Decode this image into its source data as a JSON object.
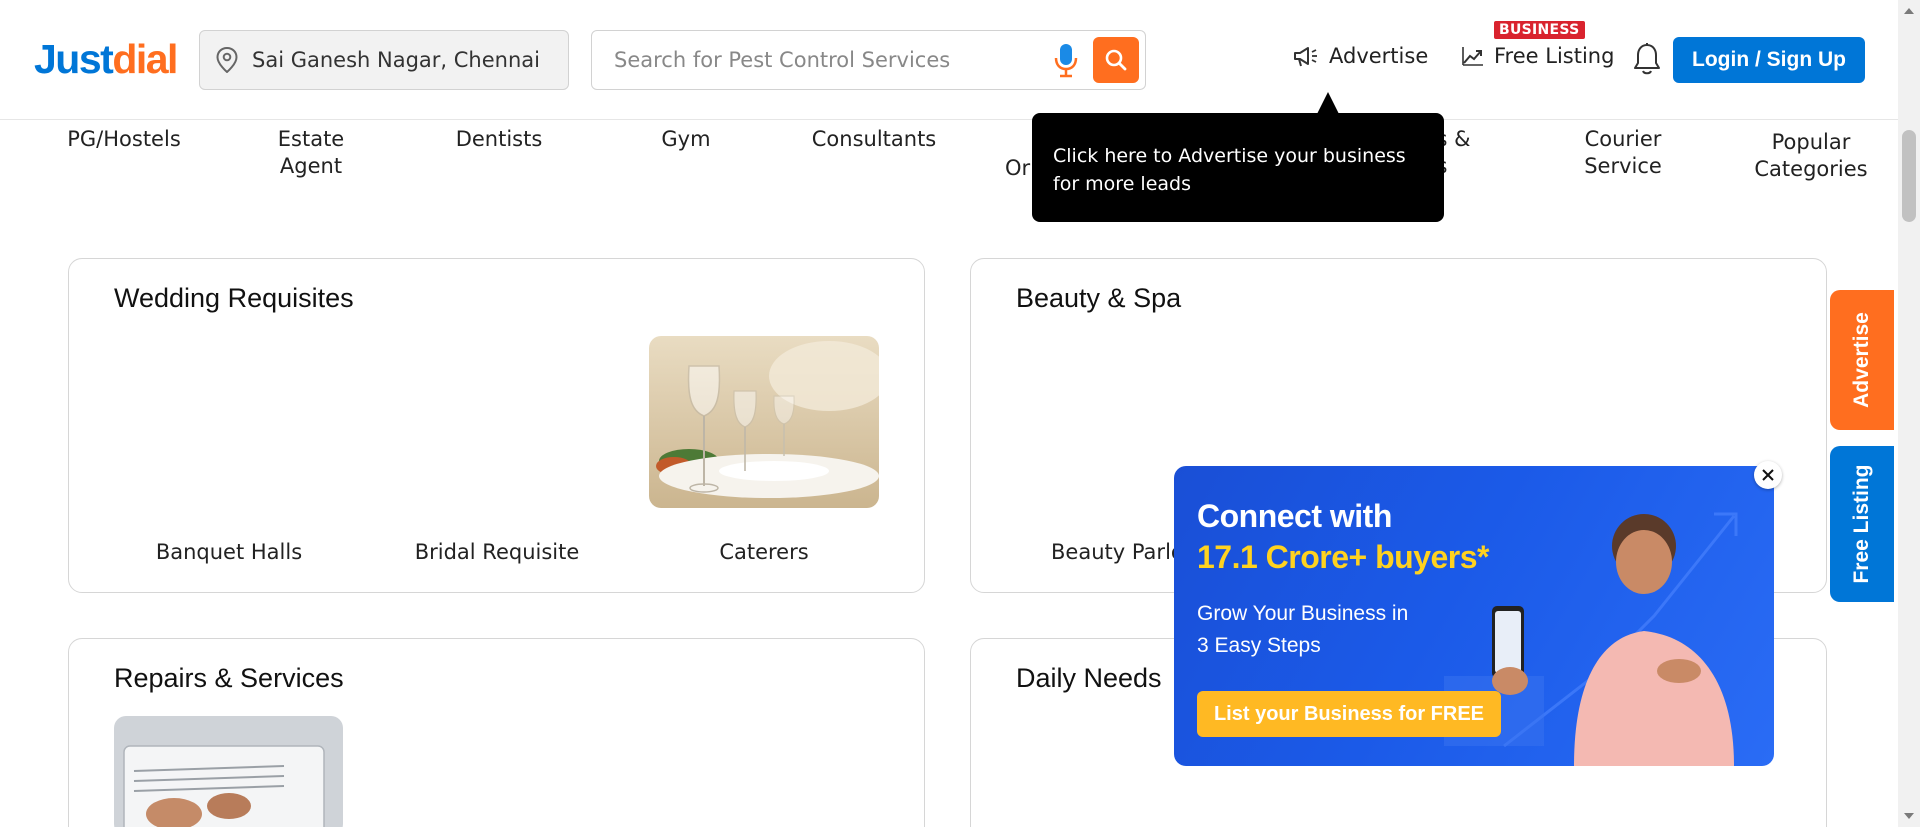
{
  "header": {
    "logo_part1": "Just",
    "logo_part2": "dial",
    "location_value": "Sai Ganesh Nagar, Chennai",
    "search_placeholder": "Search for Pest Control Services",
    "advertise_label": "Advertise",
    "business_badge": "BUSINESS",
    "free_listing_label": "Free Listing",
    "login_label": "Login / Sign Up"
  },
  "categories": [
    {
      "line1": "PG/Hostels",
      "line2": ""
    },
    {
      "line1": "Estate",
      "line2": "Agent"
    },
    {
      "line1": "Dentists",
      "line2": ""
    },
    {
      "line1": "Gym",
      "line2": ""
    },
    {
      "line1": "Consultants",
      "line2": ""
    },
    {
      "line1": "Or",
      "line2": ""
    },
    {
      "line1": "ers &",
      "line2": "ers"
    },
    {
      "line1": "Courier",
      "line2": "Service"
    },
    {
      "line1": "Popular",
      "line2": "Categories"
    }
  ],
  "tooltip": {
    "text_line1": "Click here to Advertise your business",
    "text_line2": "for more leads"
  },
  "sections": {
    "wedding": {
      "title": "Wedding Requisites",
      "items": [
        "Banquet Halls",
        "Bridal Requisite",
        "Caterers"
      ]
    },
    "beauty": {
      "title": "Beauty & Spa",
      "items": [
        "Beauty Parlo"
      ]
    },
    "repairs": {
      "title": "Repairs & Services"
    },
    "daily": {
      "title": "Daily Needs"
    }
  },
  "side_tabs": {
    "advertise": "Advertise",
    "free_listing": "Free Listing"
  },
  "promo": {
    "line1": "Connect with",
    "line2": "17.1 Crore+ buyers*",
    "line3a": "Grow Your Business in",
    "line3b": "3 Easy Steps",
    "cta": "List your Business for FREE"
  },
  "colors": {
    "brand_blue": "#0076d7",
    "brand_orange": "#ff6e1f",
    "promo_yellow": "#ffd21f"
  }
}
